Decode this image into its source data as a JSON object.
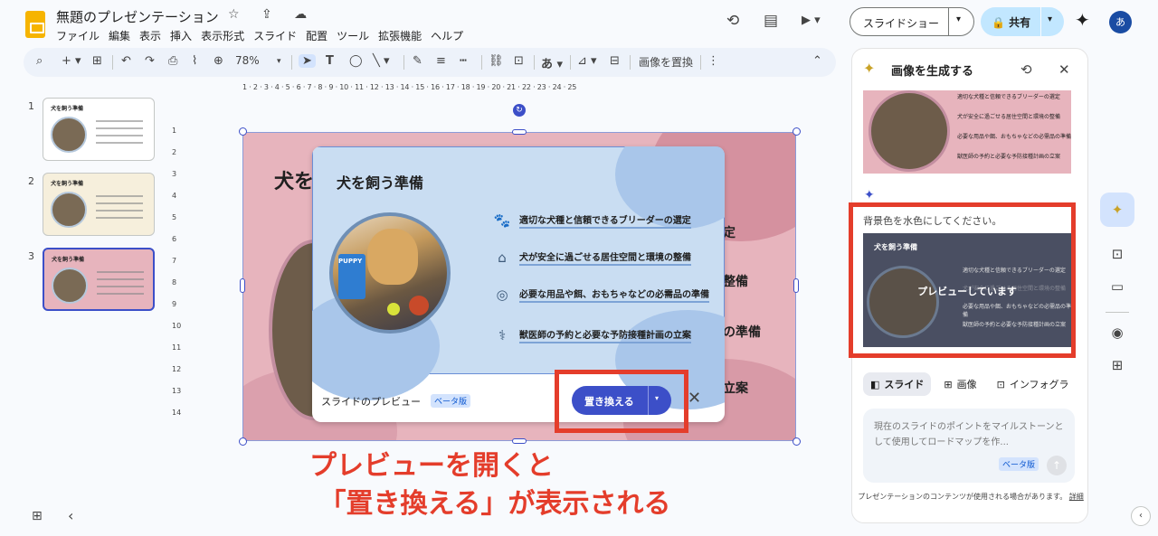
{
  "header": {
    "title": "無題のプレゼンテーション",
    "title_icons": "☆ ⇪ ☁",
    "menu": [
      "ファイル",
      "編集",
      "表示",
      "挿入",
      "表示形式",
      "スライド",
      "配置",
      "ツール",
      "拡張機能",
      "ヘルプ"
    ],
    "history_icon": "⟲",
    "comment_icon": "▤",
    "meet_icon": "▶ ▾",
    "slideshow_label": "スライドショー",
    "slideshow_arrow": "▾",
    "share_label": "🔒 共有",
    "share_arrow": "▾",
    "gemini_icon": "✦",
    "avatar_letter": "あ"
  },
  "toolbar": {
    "search": "⌕",
    "new": "+ ▾",
    "new_slide": "⊞",
    "undo": "↶",
    "redo": "↷",
    "print": "⎙",
    "paint": "⌇",
    "zoom_icon": "⊕",
    "zoom": "78%",
    "zoom_arrow": "▾",
    "select": "➤",
    "textbox": "T",
    "shape": "◯",
    "line": "╲ ▾",
    "pen": "✎",
    "border_weight": "≡",
    "border_dash": "┅",
    "link": "⛓",
    "comment": "⊡",
    "font": "あ ▾",
    "crop": "⊿ ▾",
    "mask": "⊟",
    "replace_image": "画像を置換",
    "more": "⋮",
    "collapse": "⌃"
  },
  "filmstrip": [
    {
      "num": "1",
      "title": "犬を飼う準備"
    },
    {
      "num": "2",
      "title": "犬を飼う準備"
    },
    {
      "num": "3",
      "title": "犬を飼う準備"
    }
  ],
  "ruler": {
    "h": "1 · 2 · 3 · 4 · 5 · 6 · 7 · 8 · 9 · 10 · 11 · 12 · 13 · 14 · 15 · 16 · 17 · 18 · 19 · 20 · 21 · 22 · 23 · 24 · 25",
    "v": [
      "1",
      "2",
      "3",
      "4",
      "5",
      "6",
      "7",
      "8",
      "9",
      "10",
      "11",
      "12",
      "13",
      "14"
    ]
  },
  "slide": {
    "title": "犬を",
    "frag1": "定",
    "frag2": "整備",
    "frag3": "の準備",
    "frag4": "立案",
    "rotate_icon": "↻"
  },
  "preview": {
    "title": "犬を飼う準備",
    "items": [
      {
        "icon": "🐾",
        "text": "適切な犬種と信頼できるブリーダーの選定"
      },
      {
        "icon": "⌂",
        "text": "犬が安全に過ごせる居住空間と環境の整備"
      },
      {
        "icon": "◎",
        "text": "必要な用品や餌、おもちゃなどの必需品の準備"
      },
      {
        "icon": "⚕",
        "text": "獣医師の予約と必要な予防接種計画の立案"
      }
    ],
    "photo_label": "PUPPY",
    "footer_label": "スライドのプレビュー",
    "beta": "ベータ版",
    "replace_label": "置き換える",
    "replace_arrow": "▾",
    "close": "✕"
  },
  "annotation": "プレビューを開くと\n 「置き換える」が表示される",
  "bottom": {
    "grid_icon": "⊞",
    "collapse_icon": "‹"
  },
  "panel": {
    "title": "画像を生成する",
    "spark_icon": "✦",
    "history_icon": "⟲",
    "close_icon": "✕",
    "result_rows": [
      "適切な犬種と信頼できるブリーダーの選定",
      "犬が安全に過ごせる居住空間と環境の整備",
      "必要な用品や餌、おもちゃなどの必需品の準備",
      "獣医師の予約と必要な予防接種計画の立案"
    ],
    "gemini_icon": "✦",
    "prompt": "背景色を水色にしてください。",
    "preview_title": "犬を飼う準備",
    "preview_rows": [
      "適切な犬種と信頼できるブリーダーの選定",
      "犬が安全に過ごせる居住空間と環境の整備",
      "必要な用品や餌、おもちゃなどの必需品の準備",
      "獣医師の予約と必要な予防接種計画の立案"
    ],
    "preview_overlay": "プレビューしています",
    "tabs": [
      {
        "icon": "◧",
        "label": "スライド"
      },
      {
        "icon": "⊞",
        "label": "画像"
      },
      {
        "icon": "⊡",
        "label": "インフォグラ"
      }
    ],
    "input_placeholder": "現在のスライドのポイントをマイルストーンとして使用してロードマップを作...",
    "input_beta": "ベータ版",
    "send_icon": "↑",
    "disclaimer": "プレゼンテーションのコンテンツが使用される場合があります。",
    "disclaimer_link": "詳細"
  },
  "rail": {
    "gen_icon": "✦",
    "keep_icon": "⊡",
    "folder_icon": "▭",
    "record_icon": "◉",
    "camera_icon": "⊞",
    "collapse_icon": "‹"
  }
}
